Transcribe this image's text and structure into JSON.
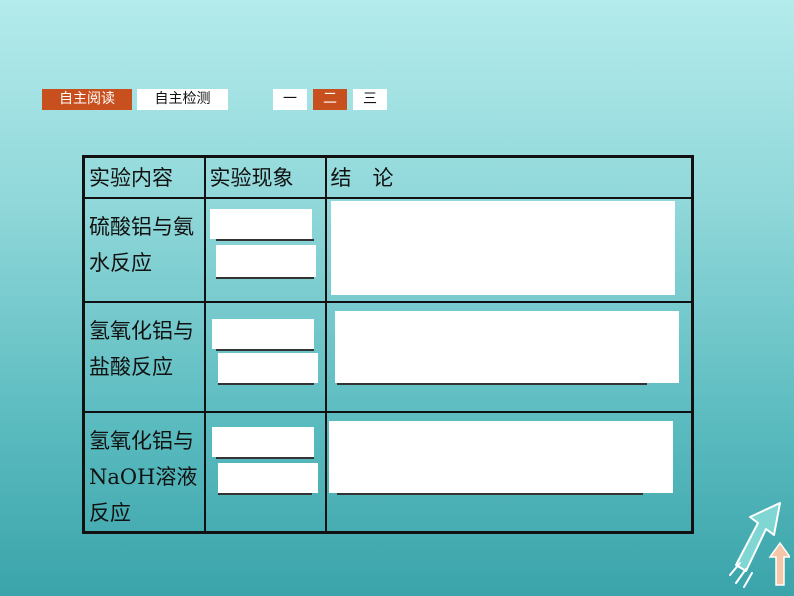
{
  "nav": {
    "tabs": [
      {
        "label": "自主阅读",
        "active": true
      },
      {
        "label": "自主检测",
        "active": false
      }
    ],
    "sections": [
      {
        "label": "一",
        "active": false
      },
      {
        "label": "二",
        "active": true
      },
      {
        "label": "三",
        "active": false
      }
    ]
  },
  "table": {
    "headers": [
      "实验内容",
      "实验现象",
      "结　论"
    ],
    "rows": [
      {
        "content": "硫酸铝与氨水反应"
      },
      {
        "content": "氢氧化铝与盐酸反应"
      },
      {
        "content": "氢氧化铝与NaOH溶液反应"
      }
    ]
  },
  "colors": {
    "active_tab": "#c8501e",
    "background_top": "#b4ebec",
    "background_bottom": "#3aa4aa"
  }
}
